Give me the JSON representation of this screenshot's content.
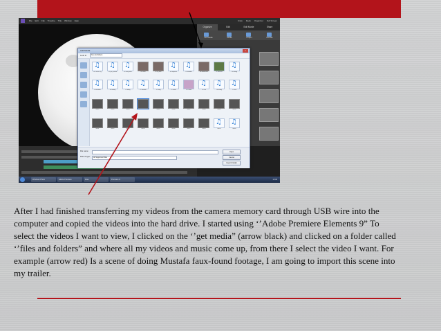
{
  "colors": {
    "accent": "#b3141b",
    "arrow_red": "#b3141b",
    "arrow_black": "#000000"
  },
  "app": {
    "menu": [
      "File",
      "Edit",
      "Clip",
      "Timeline",
      "Title",
      "Window",
      "Help"
    ],
    "menu_right": [
      "Undo",
      "Redo",
      "Organizer",
      "Full Screen"
    ],
    "panel_tabs": [
      "Organize",
      "Edit",
      "Edit Movie",
      "Share"
    ],
    "get_media_items": [
      "Get Media",
      "Media",
      "Project",
      "Flexible"
    ]
  },
  "dialog": {
    "title": "Add Media",
    "look_in_label": "Look in:",
    "look_in_value": "files and folders",
    "file_name_label": "File name:",
    "files_of_type_label": "Files of type:",
    "files_of_type_value": "All Supported Files",
    "open_button": "Open",
    "cancel_button": "Cancel",
    "import_folder_button": "Import Folder",
    "row1": [
      "01 Prince Tiny",
      "02 you_should",
      "03 Pony Stars",
      "04 Chloe",
      "05 In_MNS",
      "06 Sixpence",
      "07 Slumber",
      "08 Melancholic",
      "09 Haunted",
      "10 coming"
    ],
    "row2": [
      "08 Shadow",
      "09 melody",
      "10 Remy",
      "11 Meadow",
      "12 Song",
      "13 Ghost",
      "14 Dream",
      "15 Run",
      "16 Shelby",
      "17 Final"
    ],
    "row3": [
      "00001",
      "00002",
      "00003",
      "00004",
      "00005",
      "00006",
      "00007",
      "00008",
      "00009",
      "00010"
    ],
    "row4": [
      "00011",
      "00012",
      "00013",
      "00014",
      "00015",
      "00016",
      "00017",
      "00018",
      "00019",
      "00020"
    ]
  },
  "taskbar": {
    "items": [
      "Windows Photo",
      "Adobe Premiere",
      "Files",
      "Premiere 9"
    ],
    "clock": "12:00"
  },
  "caption": "After I had finished transferring  my videos from the camera memory card through USB wire into the computer and copied the videos into the hard drive. I started using ‘’Adobe Premiere Elements 9” To select the videos I want to view, I clicked on the ‘’get media” (arrow black) and clicked on a folder called ‘’files and folders” and where all my videos and music come up, from there I select the video I want. For example (arrow red) Is a scene of doing Mustafa faux-found footage, I am going to import this scene into my trailer."
}
